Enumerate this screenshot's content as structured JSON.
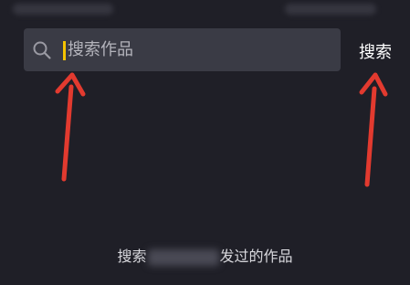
{
  "search": {
    "placeholder": "搜索作品",
    "value": ""
  },
  "header": {
    "search_button_label": "搜索"
  },
  "empty_state": {
    "prefix": "搜索",
    "suffix": "发过的作品"
  },
  "icons": {
    "search": "search-icon",
    "annotation_arrow": "arrow-up-icon"
  },
  "colors": {
    "background": "#1f1f27",
    "search_box": "#3a3b45",
    "caret": "#f4c300",
    "annotation_arrow": "#e23a2f"
  }
}
